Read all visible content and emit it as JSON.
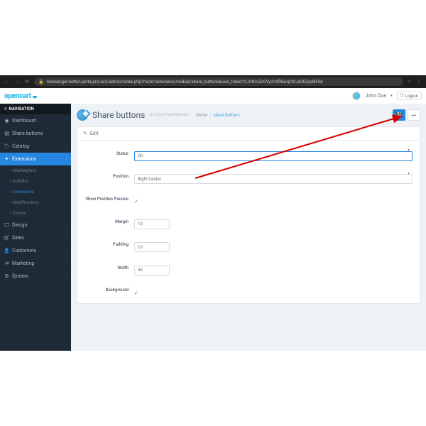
{
  "browser": {
    "url": "messenger.button.pinta.pro/oc3/admin/index.php?route=extension/module/share_buttons&user_token=CJIrRmZcGYyVmfR0wqCbtJaVEQq4BFiM"
  },
  "header": {
    "logo": "opencart",
    "user": "John Doe",
    "logout": "Logout"
  },
  "sidebar": {
    "title": "NAVIGATION",
    "items": [
      {
        "label": "Dashboard"
      },
      {
        "label": "Share buttons"
      },
      {
        "label": "Catalog"
      },
      {
        "label": "Extensions"
      },
      {
        "label": "Design"
      },
      {
        "label": "Sales"
      },
      {
        "label": "Customers"
      },
      {
        "label": "Marketing"
      },
      {
        "label": "System"
      }
    ],
    "subs": [
      {
        "label": "Marketplace"
      },
      {
        "label": "Installer"
      },
      {
        "label": "Extensions"
      },
      {
        "label": "Modifications"
      },
      {
        "label": "Events"
      }
    ]
  },
  "page": {
    "title": "Share buttons",
    "meta": "(2.1.2) by Pinta Webware",
    "breadcrumb": {
      "home": "Home",
      "current": "share buttons"
    }
  },
  "panel": {
    "edit": "Edit"
  },
  "form": {
    "status": {
      "label": "Status",
      "value": "On"
    },
    "position": {
      "label": "Position",
      "value": "Right Center"
    },
    "show_params": {
      "label": "Show Position Params"
    },
    "margin": {
      "label": "Margin",
      "value": "10"
    },
    "padding": {
      "label": "Padding",
      "value": "10"
    },
    "width": {
      "label": "Width",
      "value": "50"
    },
    "background": {
      "label": "Background"
    }
  }
}
